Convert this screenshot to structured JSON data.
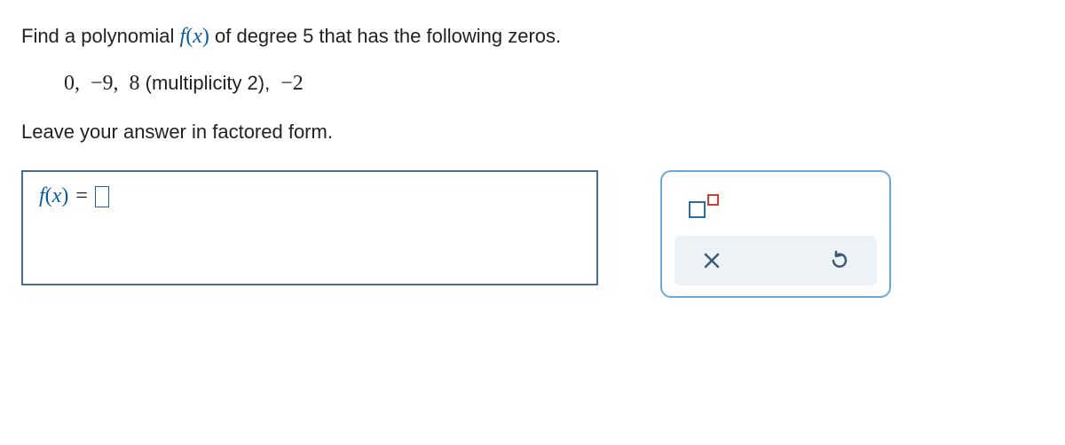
{
  "prompt": {
    "prefix": "Find a polynomial ",
    "fx_f": "f",
    "fx_open": "(",
    "fx_x": "x",
    "fx_close": ")",
    "suffix": " of degree 5 that has the following zeros."
  },
  "zeros_display": {
    "z1": "0,",
    "z2": "−9,",
    "z3_val": "8",
    "z3_mult": " (multiplicity 2),",
    "z4": "−2"
  },
  "instruction": "Leave your answer in factored form.",
  "answer": {
    "lhs_f": "f",
    "lhs_open": "(",
    "lhs_x": "x",
    "lhs_close": ")",
    "eq": "=",
    "input_value": ""
  },
  "tools": {
    "exponent": "exponent-button",
    "clear": "clear-x",
    "reset": "reset-undo"
  }
}
